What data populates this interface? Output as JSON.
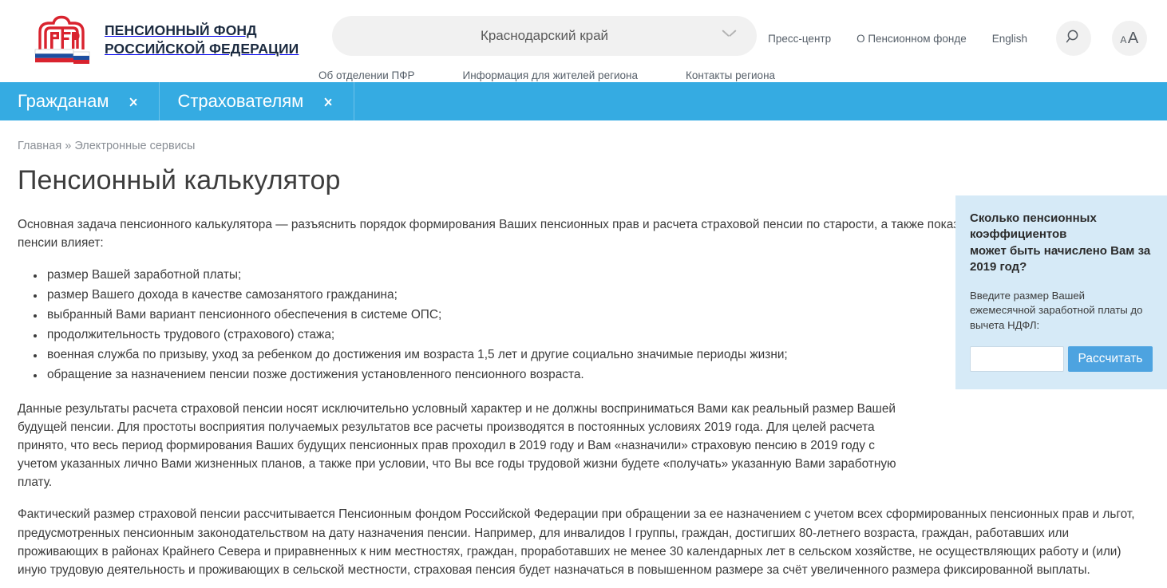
{
  "brand": {
    "logo_icon": "pfr-emblem-icon",
    "title_line1": "ПЕНСИОННЫЙ ФОНД",
    "title_line2": "РОССИЙСКОЙ ФЕДЕРАЦИИ"
  },
  "header": {
    "region": {
      "selected": "Краснодарский край",
      "chevron_icon": "chevron-down-icon"
    },
    "region_links": [
      "Об отделении  ПФР",
      "Информация для жителей региона",
      "Контакты региона"
    ],
    "top_links": [
      "Пресс-центр",
      "О Пенсионном фонде",
      "English"
    ],
    "search_icon": "search-icon",
    "fontsize_small": "A",
    "fontsize_large": "A"
  },
  "mainnav": {
    "items": [
      {
        "label": "Гражданам",
        "arrow_icon": "chevron-right-icon"
      },
      {
        "label": "Страхователям",
        "arrow_icon": "chevron-right-icon"
      }
    ],
    "background": "#35abe2"
  },
  "breadcrumb": {
    "home": "Главная",
    "separator": "»",
    "current": "Электронные сервисы"
  },
  "page": {
    "title": "Пенсионный калькулятор",
    "intro": "Основная задача пенсионного калькулятора — разъяснить порядок формирования Ваших пенсионных прав и расчета страховой пенсии по старости, а также показать, как на размер страховой пенсии влияет:",
    "bullets": [
      "размер Вашей заработной платы;",
      "размер Вашего дохода в качестве самозанятого гражданина;",
      "выбранный Вами вариант пенсионного обеспечения в системе ОПС;",
      "продолжительность трудового (страхового) стажа;",
      "военная служба по призыву, уход за ребенком до достижения им возраста 1,5 лет и другие социально значимые периоды жизни;",
      "обращение за назначением пенсии позже достижения установленного пенсионного возраста."
    ],
    "paragraph_2": "Данные результаты расчета страховой пенсии носят исключительно условный характер и не должны восприниматься Вами как реальный размер Вашей будущей пенсии. Для простоты восприятия получаемых результатов все расчеты производятся в постоянных условиях 2019 года. Для целей расчета принято, что весь период формирования Ваших будущих пенсионных прав проходил в 2019 году и Вам «назначили» страховую пенсию в 2019 году с учетом указанных лично Вами жизненных планов, а также при условии, что Вы все годы трудовой жизни будете «получать» указанную Вами заработную плату.",
    "paragraph_3": "Фактический размер страховой пенсии рассчитывается Пенсионным фондом Российской Федерации при обращении за ее назначением с учетом всех сформированных пенсионных прав и льгот, предусмотренных пенсионным законодательством на дату назначения пенсии. Например, для инвалидов I группы, граждан, достигших 80-летнего возраста, граждан, работавших или проживающих в районах Крайнего Севера и приравненных к ним местностях, граждан, проработавших не менее 30 календарных лет в сельском хозяйстве, не осуществляющих работу и (или) иную трудовую деятельность и проживающих в сельской местности, страховая пенсия будет назначаться в повышенном размере за счёт увеличенного размера фиксированной выплаты."
  },
  "calc_widget": {
    "title": "Сколько пенсионных коэффициентов\nможет быть начислено Вам за 2019 год?",
    "subtitle": "Введите размер Вашей ежемесячной заработной платы до вычета НДФЛ:",
    "input_value": "",
    "input_placeholder": "",
    "button_label": "Рассчитать",
    "background": "#d6eaf7",
    "button_color": "#4da3e0"
  }
}
